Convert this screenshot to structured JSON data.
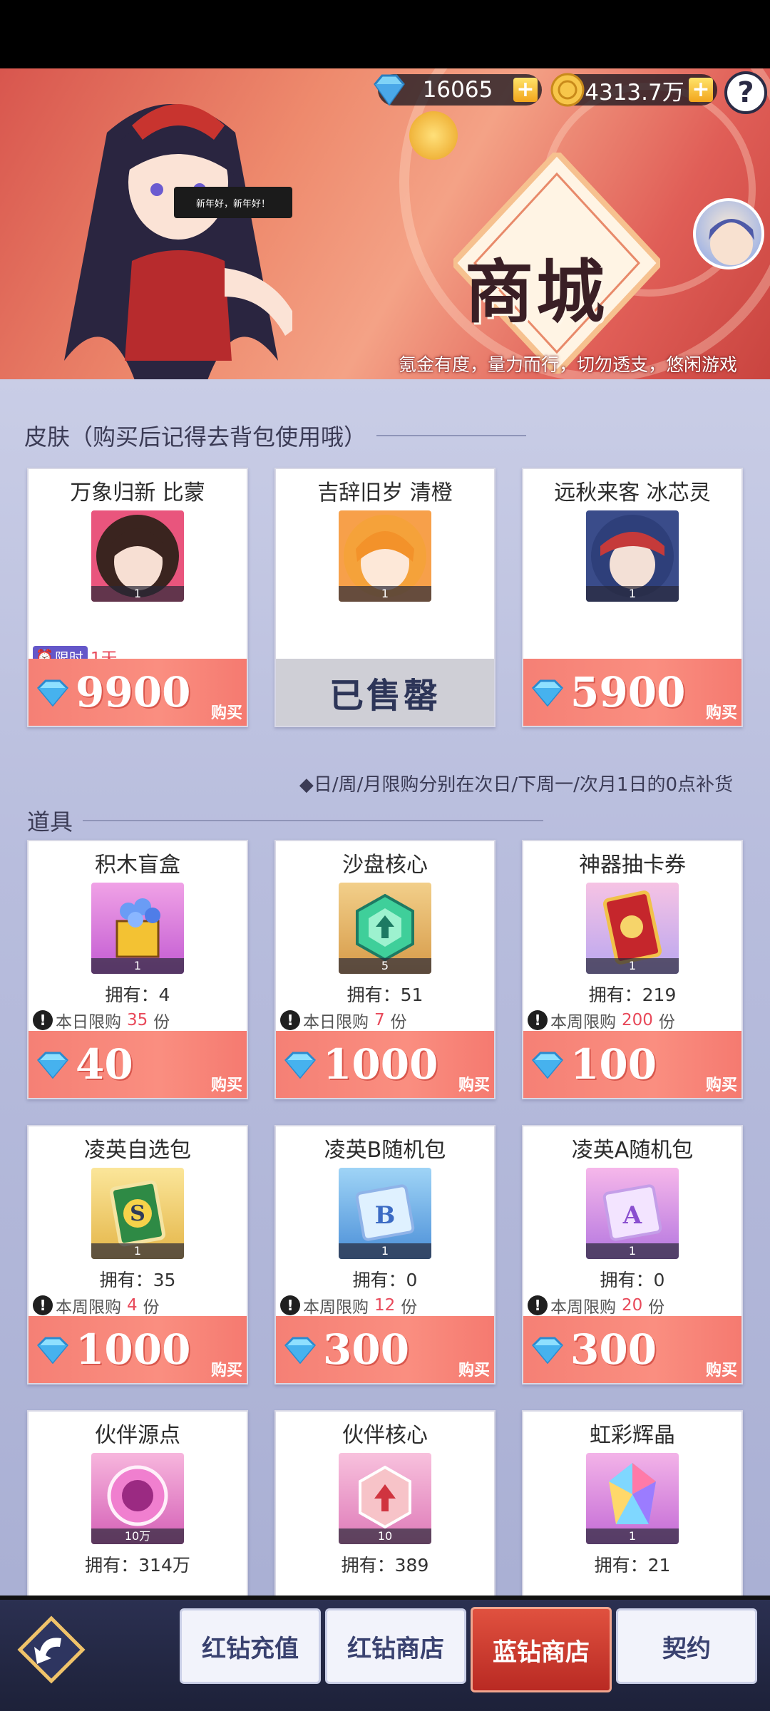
{
  "header": {
    "diamonds": "16065",
    "gold": "4313.7万",
    "help_label": "?",
    "speech_bubble": "新年好，新年好！",
    "shop_title": "商城",
    "slogan": "氪金有度，量力而行，切勿透支，悠闲游戏"
  },
  "skins": {
    "section_title": "皮肤（购买后记得去背包使用哦）",
    "items": [
      {
        "name": "万象归新 比蒙",
        "qty": "1",
        "timer_tag": "限时",
        "timer_value": "1天",
        "price": "9900",
        "buy": "购买",
        "sold_out": false
      },
      {
        "name": "吉辞旧岁 清橙",
        "qty": "1",
        "sold_label": "已售罄",
        "sold_out": true
      },
      {
        "name": "远秋来客 冰芯灵",
        "qty": "1",
        "price": "5900",
        "buy": "购买",
        "sold_out": false
      }
    ]
  },
  "props": {
    "section_title": "道具",
    "restock_note": "◆日/周/月限购分别在次日/下周一/次月1日的0点补货",
    "items": [
      {
        "name": "积木盲盒",
        "qty": "1",
        "owned": "拥有：4",
        "limit_type": "本日限购",
        "limit_num": "35",
        "limit_unit": "份",
        "price": "40",
        "buy": "购买"
      },
      {
        "name": "沙盘核心",
        "qty": "5",
        "owned": "拥有：51",
        "limit_type": "本日限购",
        "limit_num": "7",
        "limit_unit": "份",
        "price": "1000",
        "buy": "购买"
      },
      {
        "name": "神器抽卡券",
        "qty": "1",
        "owned": "拥有：219",
        "limit_type": "本周限购",
        "limit_num": "200",
        "limit_unit": "份",
        "price": "100",
        "buy": "购买"
      },
      {
        "name": "凌英自选包",
        "qty": "1",
        "owned": "拥有：35",
        "limit_type": "本周限购",
        "limit_num": "4",
        "limit_unit": "份",
        "price": "1000",
        "buy": "购买"
      },
      {
        "name": "凌英B随机包",
        "qty": "1",
        "owned": "拥有：0",
        "limit_type": "本周限购",
        "limit_num": "12",
        "limit_unit": "份",
        "price": "300",
        "buy": "购买"
      },
      {
        "name": "凌英A随机包",
        "qty": "1",
        "owned": "拥有：0",
        "limit_type": "本周限购",
        "limit_num": "20",
        "limit_unit": "份",
        "price": "300",
        "buy": "购买"
      },
      {
        "name": "伙伴源点",
        "qty": "10万",
        "owned": "拥有：314万"
      },
      {
        "name": "伙伴核心",
        "qty": "10",
        "owned": "拥有：389"
      },
      {
        "name": "虹彩辉晶",
        "qty": "1",
        "owned": "拥有：21"
      }
    ]
  },
  "nav": {
    "tabs": [
      "红钻充值",
      "红钻商店",
      "蓝钻商店",
      "契约"
    ],
    "active": "蓝钻商店"
  },
  "colors": {
    "accent_price": "#f58075",
    "limit_number": "#e8495a",
    "active_tab": "#c9302a",
    "content_bg": "#b8bddd"
  }
}
